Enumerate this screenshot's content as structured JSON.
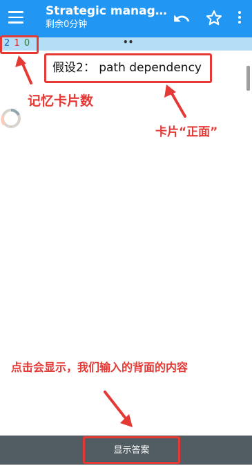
{
  "app_bar": {
    "title": "Strategic manage...",
    "subtitle": "剩余0分钟",
    "menu_icon": "hamburger-menu-icon",
    "undo_icon": "undo-icon",
    "star_icon": "star-outline-icon",
    "more_icon": "more-vertical-icon"
  },
  "counts": {
    "new": "2",
    "learn": "1",
    "review": "0"
  },
  "progress_dots": "••",
  "card": {
    "front": "假设2： path dependency"
  },
  "bottom_bar": {
    "show_answer": "显示答案"
  },
  "annotations": {
    "memory_count": "记忆卡片数",
    "card_front": "卡片“正面”",
    "show_hint": "点击会显示，我们输入的背面的内容"
  },
  "colors": {
    "app_bar": "#2196f3",
    "counts_bar": "#b3def5",
    "bottom_bar": "#525d63",
    "annotation": "#e53935",
    "count_new": "#1565c0",
    "count_learn": "#c62828",
    "count_review": "#2e7d32"
  }
}
